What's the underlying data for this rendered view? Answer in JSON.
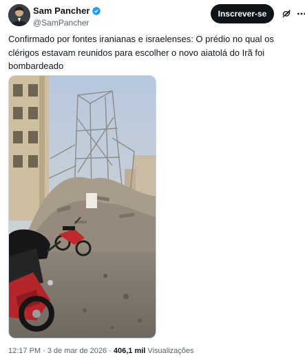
{
  "author": {
    "display_name": "Sam Pancher",
    "handle": "@SamPancher",
    "verified": true
  },
  "actions": {
    "follow_label": "Inscrever-se",
    "grok_icon": "grok-icon",
    "more_icon": "more-options-icon"
  },
  "tweet": {
    "text": "Confirmado por fontes iranianas e israelenses: O prédio no qual os clérigos estavam reunidos para escolher o novo aiatolá do Irã foi bombardeado"
  },
  "media": {
    "type": "video",
    "description_icon": "video-thumbnail"
  },
  "meta": {
    "time": "12:17 PM",
    "separator": " · ",
    "date": "3 de mar de 2026",
    "views_count": "406,1 mil",
    "views_label": " Visualizações"
  },
  "colors": {
    "verified": "#1d9bf0",
    "follow_bg": "#0f1419",
    "secondary_text": "#536471"
  }
}
